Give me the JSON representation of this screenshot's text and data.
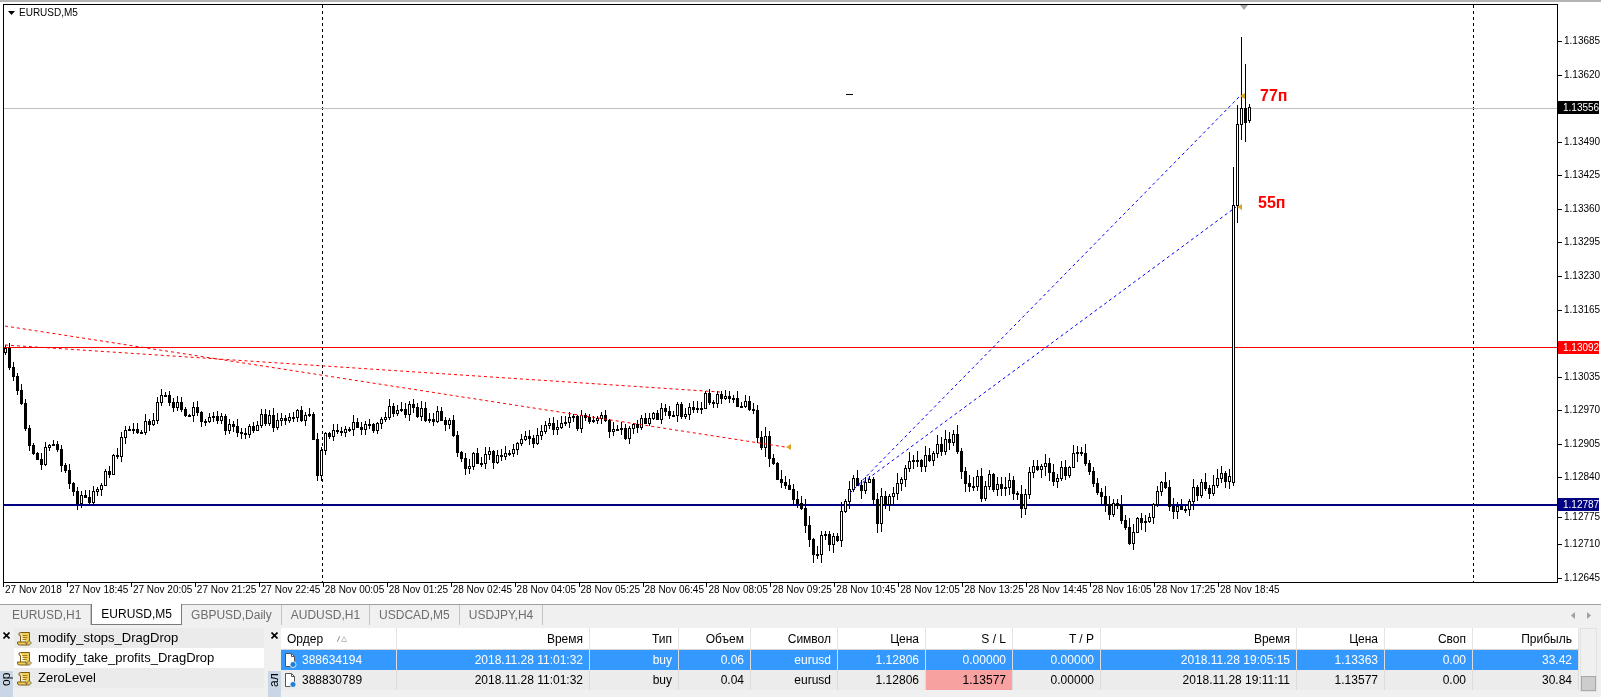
{
  "chart": {
    "title": "EURUSD,M5",
    "annotations": [
      "77п",
      "55п"
    ]
  },
  "price_axis": {
    "ticks": [
      "1.13685",
      "1.13620",
      "1.13490",
      "1.13425",
      "1.13360",
      "1.13295",
      "1.13230",
      "1.13165",
      "1.13035",
      "1.12970",
      "1.12905",
      "1.12840",
      "1.12775",
      "1.12710",
      "1.12645"
    ],
    "line_labels": [
      {
        "kind": "bid",
        "text": "1.13556",
        "color": "#000000"
      },
      {
        "kind": "level",
        "text": "1.13092",
        "color": "#ff0000"
      },
      {
        "kind": "level_bold",
        "text": "1.12787",
        "color": "#000080"
      }
    ]
  },
  "time_axis": {
    "labels": [
      "27 Nov 2018",
      "27 Nov 18:45",
      "27 Nov 20:05",
      "27 Nov 21:25",
      "27 Nov 22:45",
      "28 Nov 00:05",
      "28 Nov 01:25",
      "28 Nov 02:45",
      "28 Nov 04:05",
      "28 Nov 05:25",
      "28 Nov 06:45",
      "28 Nov 08:05",
      "28 Nov 09:25",
      "28 Nov 10:45",
      "28 Nov 12:05",
      "28 Nov 13:25",
      "28 Nov 14:45",
      "28 Nov 16:05",
      "28 Nov 17:25",
      "28 Nov 18:45"
    ]
  },
  "tabs": [
    {
      "label": "EURUSD,H1",
      "selected": false
    },
    {
      "label": "EURUSD,M5",
      "selected": true
    },
    {
      "label": "GBPUSD,Daily",
      "selected": false
    },
    {
      "label": "AUDUSD,H1",
      "selected": false
    },
    {
      "label": "USDCAD,M5",
      "selected": false
    },
    {
      "label": "USDJPY,H4",
      "selected": false
    }
  ],
  "navigator": {
    "side_tab": "ор",
    "items": [
      {
        "label": "modify_stops_DragDrop"
      },
      {
        "label": "modify_take_profits_DragDrop"
      },
      {
        "label": "ZeroLevel"
      }
    ]
  },
  "terminal": {
    "side_tab": "ал",
    "columns": [
      "Ордер",
      "Время",
      "Тип",
      "Объем",
      "Символ",
      "Цена",
      "S / L",
      "T / P",
      "Время",
      "Цена",
      "Своп",
      "Прибыль"
    ],
    "rows": [
      {
        "selected": true,
        "sl_highlighted": false,
        "cells": [
          "388634194",
          "2018.11.28 11:01:32",
          "buy",
          "0.06",
          "eurusd",
          "1.12806",
          "0.00000",
          "0.00000",
          "2018.11.28 19:05:15",
          "1.13363",
          "0.00",
          "33.42"
        ]
      },
      {
        "selected": false,
        "sl_highlighted": true,
        "cells": [
          "388830789",
          "2018.11.28 11:01:32",
          "buy",
          "0.04",
          "eurusd",
          "1.12806",
          "1.13577",
          "0.00000",
          "2018.11.28 19:11:11",
          "1.13577",
          "0.00",
          "30.84"
        ]
      }
    ]
  }
}
